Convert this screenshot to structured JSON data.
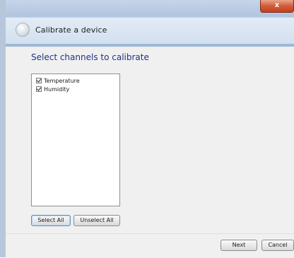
{
  "window": {
    "title": "Calibrate a device",
    "close_label": "x"
  },
  "main": {
    "heading": "Select channels to calibrate",
    "channels": [
      {
        "label": "Temperature",
        "checked": true
      },
      {
        "label": "Humidity",
        "checked": true
      }
    ],
    "select_all_label": "Select All",
    "unselect_all_label": "Unselect All"
  },
  "footer": {
    "next_label": "Next",
    "cancel_label": "Cancel"
  }
}
